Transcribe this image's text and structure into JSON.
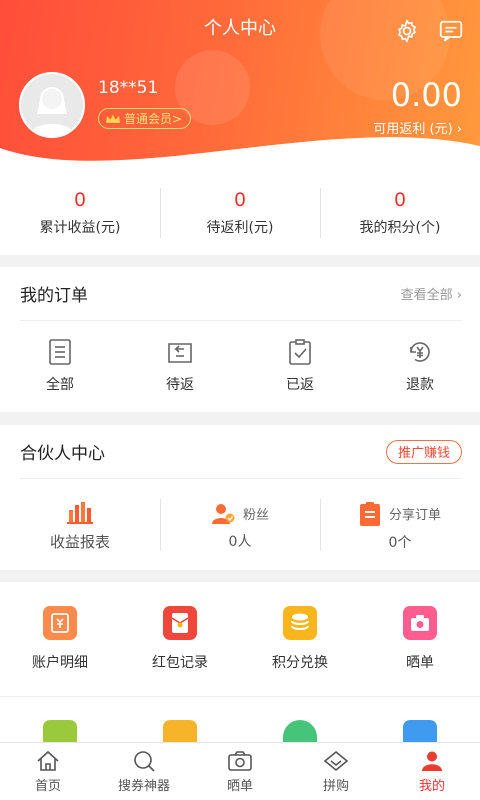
{
  "header": {
    "title": "个人中心",
    "phone": "18**51",
    "member_badge": "普通会员>",
    "balance": "0.00",
    "balance_label": "可用返利 (元)"
  },
  "stats": [
    {
      "value": "0",
      "label": "累计收益(元)"
    },
    {
      "value": "0",
      "label": "待返利(元)"
    },
    {
      "value": "0",
      "label": "我的积分(个)"
    }
  ],
  "orders": {
    "title": "我的订单",
    "view_all": "查看全部",
    "items": [
      {
        "label": "全部",
        "icon": "list-icon"
      },
      {
        "label": "待返",
        "icon": "return-icon"
      },
      {
        "label": "已返",
        "icon": "clipboard-check-icon"
      },
      {
        "label": "退款",
        "icon": "refund-icon"
      }
    ]
  },
  "partner": {
    "title": "合伙人中心",
    "promo_button": "推广赚钱",
    "items": [
      {
        "label": "收益报表",
        "icon": "bar-chart-icon"
      },
      {
        "label": "粉丝",
        "value": "0人",
        "icon": "fans-icon"
      },
      {
        "label": "分享订单",
        "value": "0个",
        "icon": "share-order-icon"
      }
    ]
  },
  "tools_row1": [
    {
      "label": "账户明细",
      "icon": "account-detail-icon",
      "color": "#ff8a4c"
    },
    {
      "label": "红包记录",
      "icon": "red-packet-icon",
      "color": "#f0473d"
    },
    {
      "label": "积分兑换",
      "icon": "coin-stack-icon",
      "color": "#f9b51c"
    },
    {
      "label": "晒单",
      "icon": "camera-icon",
      "color": "#ff5d8f"
    }
  ],
  "tools_row2": [
    {
      "icon": "cart-icon",
      "color": "#9ac93c"
    },
    {
      "icon": "shield-icon",
      "color": "#f6b42a"
    },
    {
      "icon": "chat-icon",
      "color": "#46c57a"
    },
    {
      "icon": "settings-icon",
      "color": "#3f9bf0"
    }
  ],
  "tabbar": [
    {
      "label": "首页",
      "icon": "home-icon"
    },
    {
      "label": "搜券神器",
      "icon": "search-icon"
    },
    {
      "label": "晒单",
      "icon": "camera-icon"
    },
    {
      "label": "拼购",
      "icon": "diamond-icon"
    },
    {
      "label": "我的",
      "icon": "user-icon",
      "active": true
    }
  ],
  "colors": {
    "accent": "#ee3b2f",
    "header_start": "#ff4d3a",
    "header_end": "#ff9a3c"
  }
}
